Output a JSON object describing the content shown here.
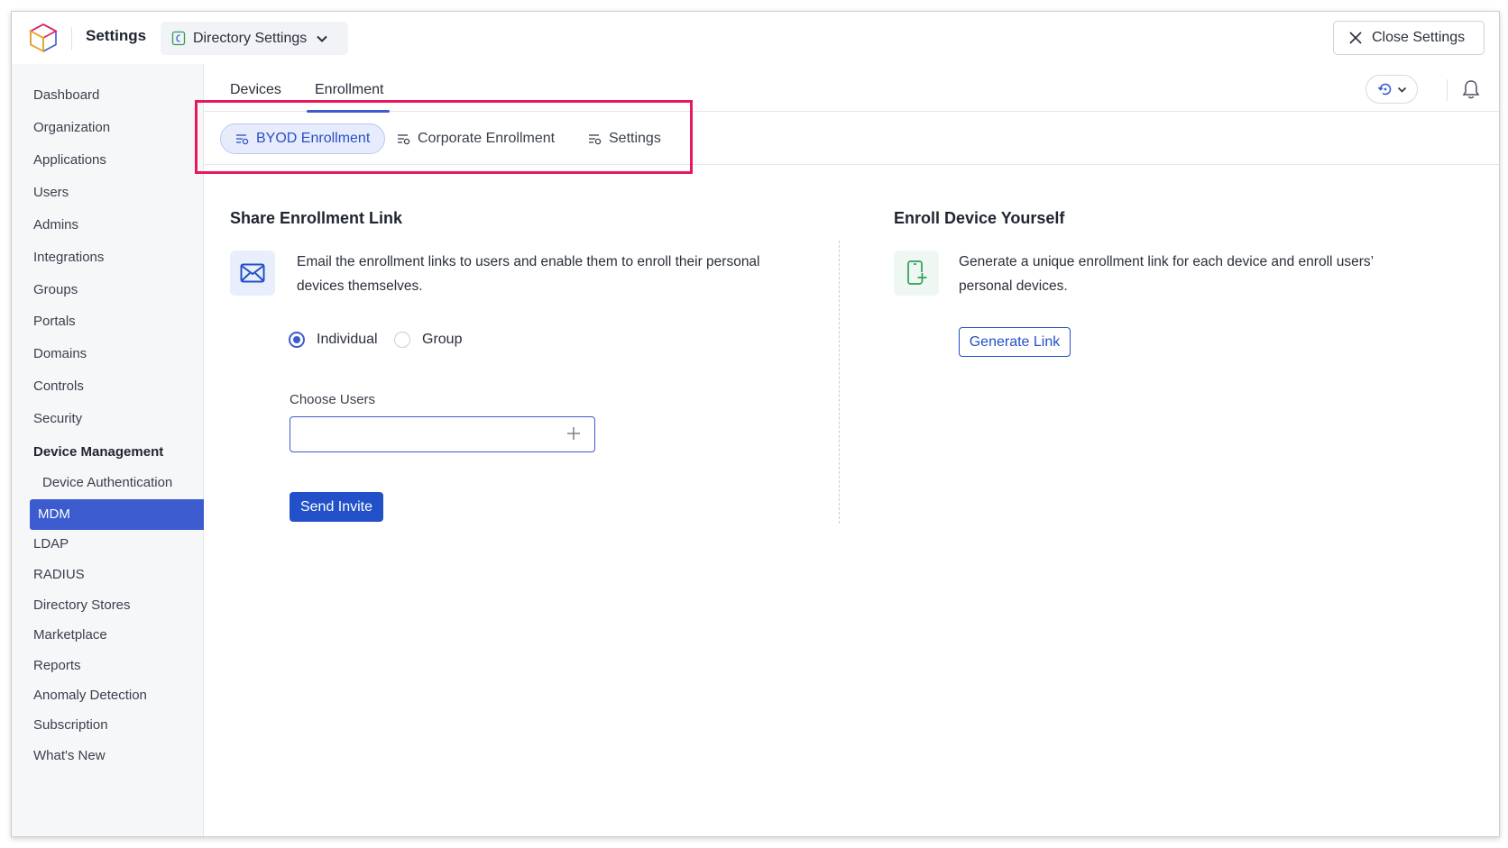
{
  "header": {
    "app_title": "Settings",
    "directory_select": "Directory Settings",
    "close_label": "Close Settings"
  },
  "sidebar": {
    "items": [
      "Dashboard",
      "Organization",
      "Applications",
      "Users",
      "Admins",
      "Integrations",
      "Groups",
      "Portals",
      "Domains",
      "Controls",
      "Security"
    ],
    "section": "Device Management",
    "sub_items": [
      "Device Authentication"
    ],
    "active": "MDM",
    "after_items": [
      "LDAP",
      "RADIUS",
      "Directory Stores",
      "Marketplace",
      "Reports",
      "Anomaly Detection",
      "Subscription",
      "What's New"
    ]
  },
  "main": {
    "tabs": [
      {
        "label": "Devices"
      },
      {
        "label": "Enrollment",
        "active": true
      }
    ],
    "subtabs": [
      {
        "label": "BYOD Enrollment",
        "active": true
      },
      {
        "label": "Corporate Enrollment"
      },
      {
        "label": "Settings"
      }
    ],
    "share": {
      "title": "Share Enrollment Link",
      "description": "Email the enrollment links to users and enable them to enroll their personal devices themselves.",
      "radio_individual": "Individual",
      "radio_group": "Group",
      "selected": "Individual",
      "choose_label": "Choose Users",
      "input_value": "",
      "send_label": "Send Invite"
    },
    "enroll": {
      "title": "Enroll Device Yourself",
      "description": "Generate a unique enrollment link for each device and enroll users’ personal devices.",
      "generate_label": "Generate Link"
    }
  },
  "colors": {
    "accent": "#3b5bcf",
    "primary_button": "#2250c8",
    "highlight_box": "#e8185a",
    "enroll_icon": "#2e9e5b"
  }
}
